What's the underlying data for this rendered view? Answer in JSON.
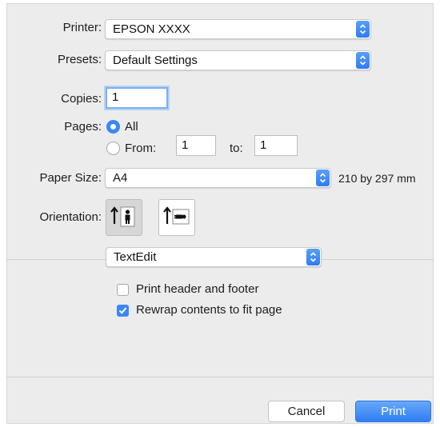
{
  "printer": {
    "label": "Printer:",
    "value": "EPSON XXXX"
  },
  "presets": {
    "label": "Presets:",
    "value": "Default Settings"
  },
  "copies": {
    "label": "Copies:",
    "value": "1"
  },
  "pages": {
    "label": "Pages:",
    "all_label": "All",
    "from_label": "From:",
    "from_value": "1",
    "to_label": "to:",
    "to_value": "1",
    "selected": "All"
  },
  "paper_size": {
    "label": "Paper Size:",
    "value": "A4",
    "dimensions": "210 by 297 mm"
  },
  "orientation": {
    "label": "Orientation:",
    "selected": "portrait",
    "icons": [
      "portrait-icon",
      "landscape-icon"
    ]
  },
  "app_panel": {
    "value": "TextEdit"
  },
  "options": {
    "print_header_footer": {
      "label": "Print header and footer",
      "checked": false
    },
    "rewrap_contents": {
      "label": "Rewrap contents to fit page",
      "checked": true
    }
  },
  "buttons": {
    "cancel": "Cancel",
    "print": "Print"
  },
  "colors": {
    "accent": "#3b86f7",
    "dialog_bg": "#ececec"
  }
}
